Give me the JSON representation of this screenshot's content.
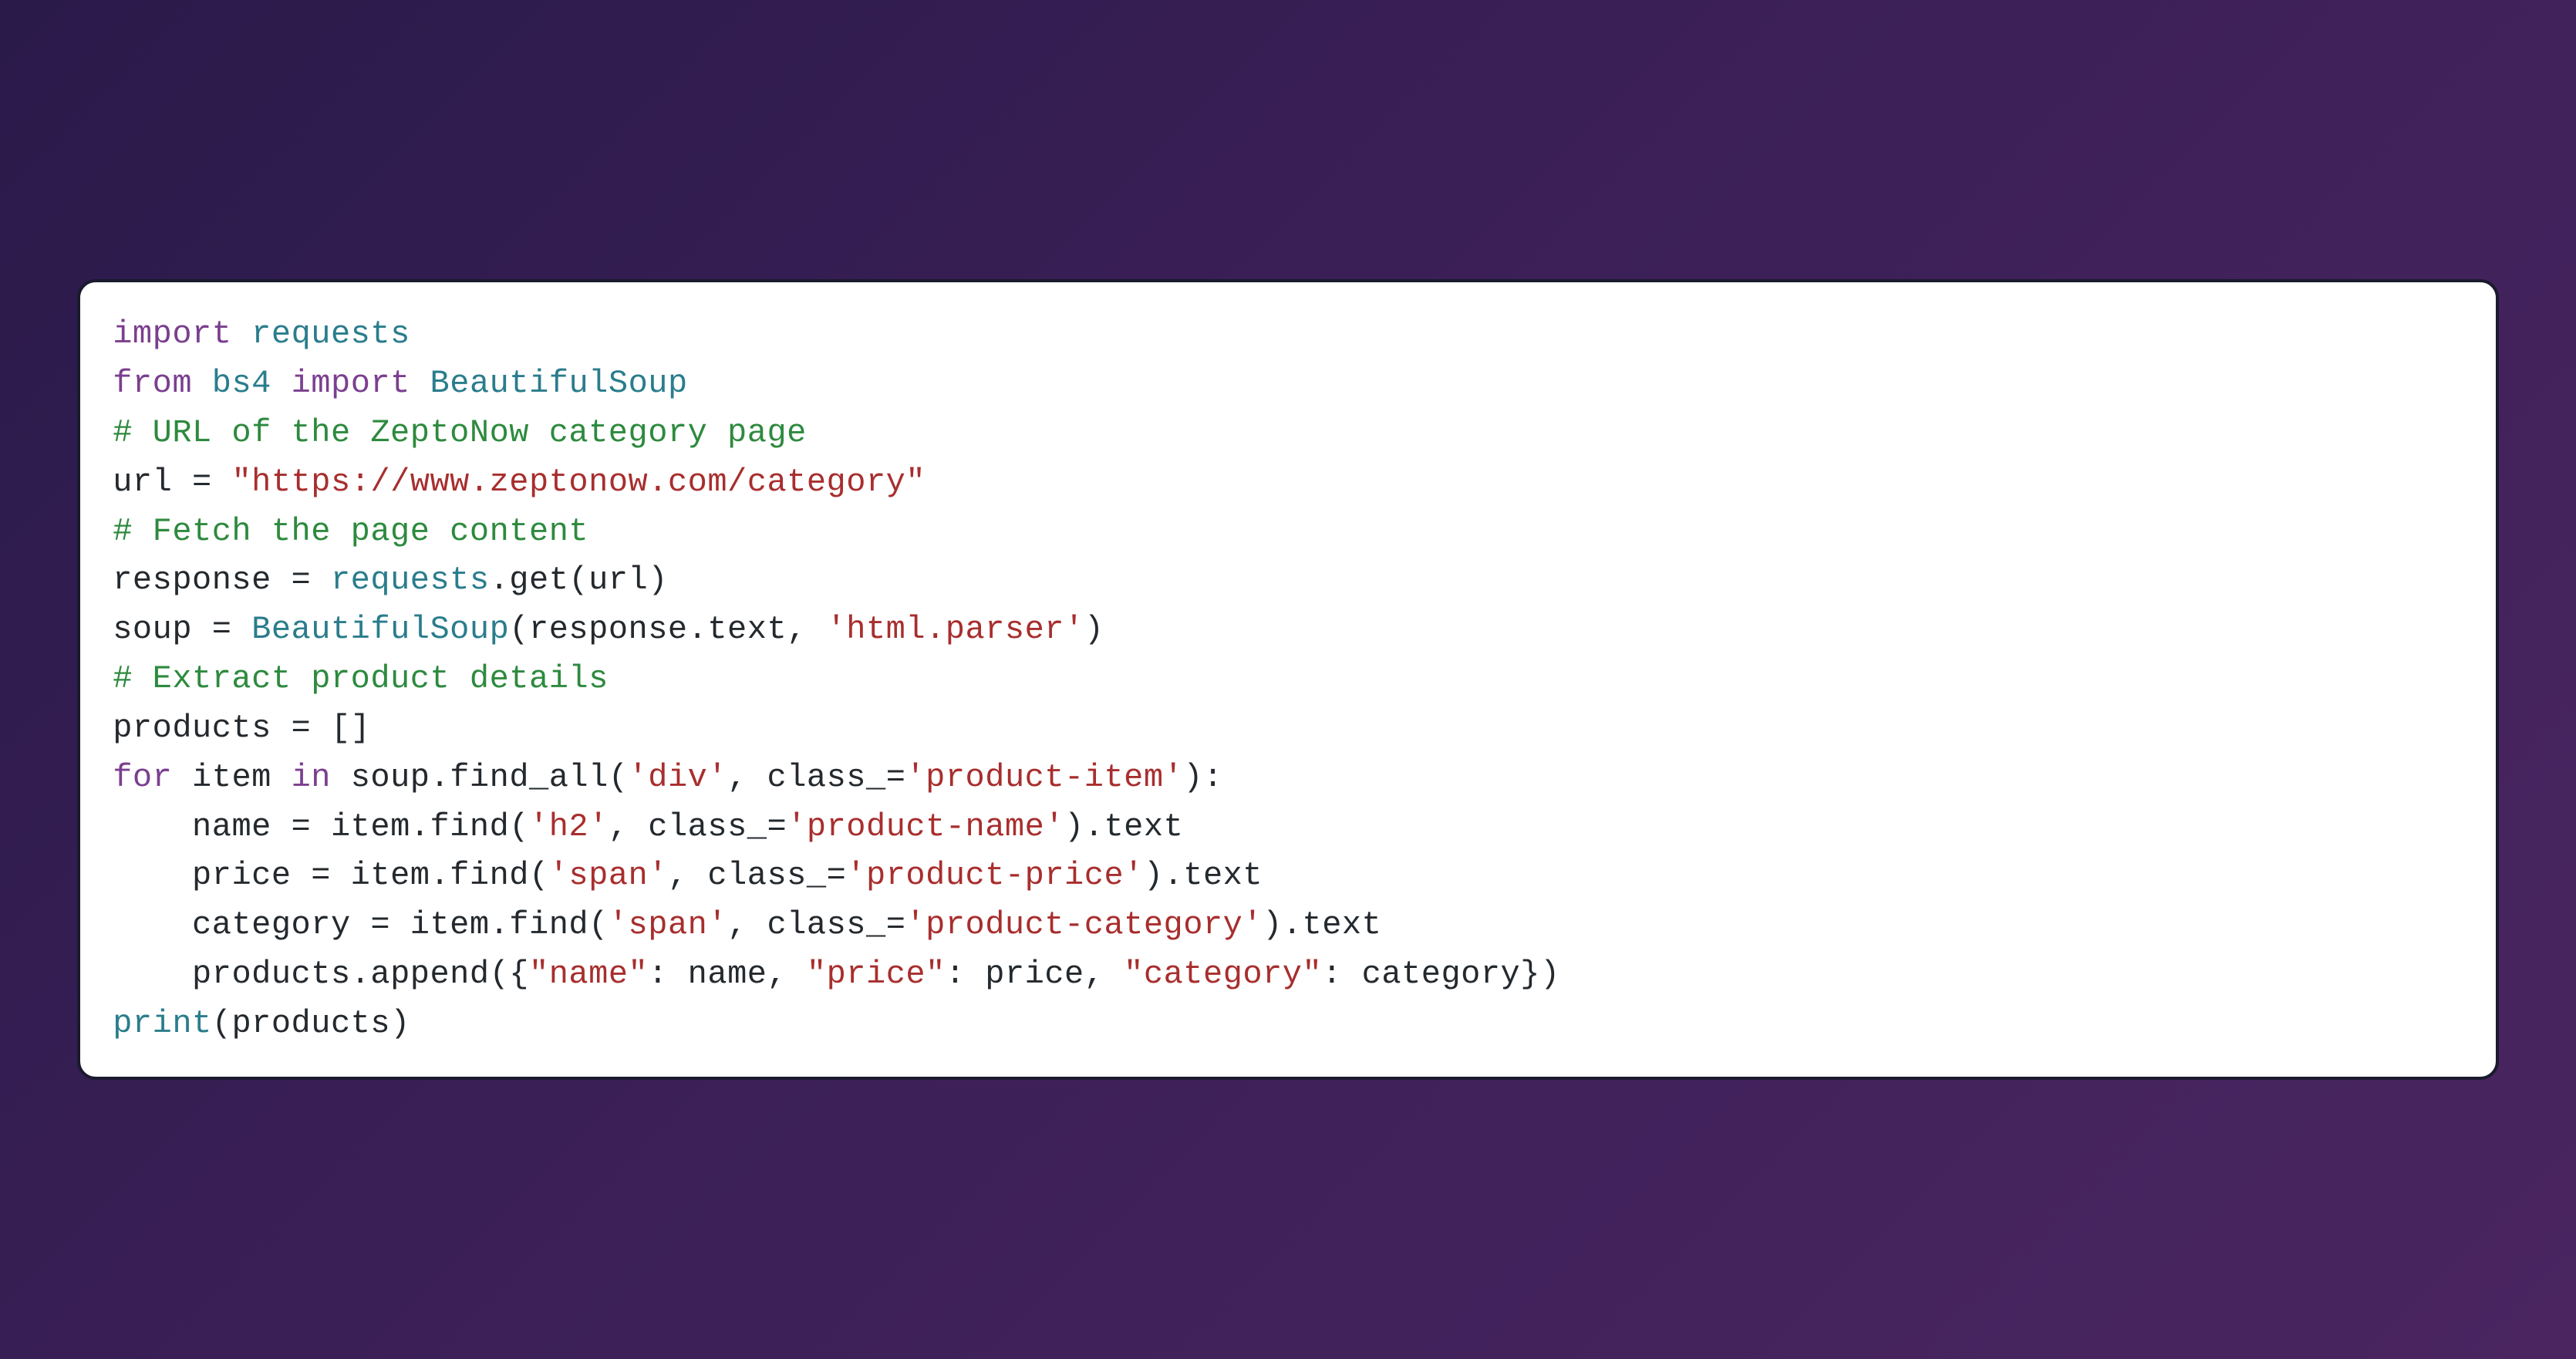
{
  "code": {
    "line1": {
      "kw": "import",
      "module": "requests"
    },
    "line2": {
      "kw1": "from",
      "module1": "bs4",
      "kw2": "import",
      "module2": "BeautifulSoup"
    },
    "line3": {
      "comment": "# URL of the ZeptoNow category page"
    },
    "line4": {
      "var": "url = ",
      "str": "\"https://www.zeptonow.com/category\""
    },
    "line5": {
      "comment": "# Fetch the page content"
    },
    "line6": {
      "text1": "response = ",
      "builtin": "requests",
      "text2": ".get(url)"
    },
    "line7": {
      "text1": "soup = ",
      "builtin": "BeautifulSoup",
      "text2": "(response.text, ",
      "str": "'html.parser'",
      "text3": ")"
    },
    "line8": {
      "comment": "# Extract product details"
    },
    "line9": {
      "text": "products = []"
    },
    "line10": {
      "kw1": "for",
      "text1": " item ",
      "kw2": "in",
      "text2": " soup.find_all(",
      "str1": "'div'",
      "text3": ", class_=",
      "str2": "'product-item'",
      "text4": "):"
    },
    "line11": {
      "indent": "    ",
      "text1": "name = item.find(",
      "str1": "'h2'",
      "text2": ", class_=",
      "str2": "'product-name'",
      "text3": ").text"
    },
    "line12": {
      "indent": "    ",
      "text1": "price = item.find(",
      "str1": "'span'",
      "text2": ", class_=",
      "str2": "'product-price'",
      "text3": ").text"
    },
    "line13": {
      "indent": "    ",
      "text1": "category = item.find(",
      "str1": "'span'",
      "text2": ", class_=",
      "str2": "'product-category'",
      "text3": ").text"
    },
    "line14": {
      "indent": "    ",
      "text1": "products.append({",
      "str1": "\"name\"",
      "text2": ": name, ",
      "str2": "\"price\"",
      "text3": ": price, ",
      "str3": "\"category\"",
      "text4": ": category})"
    },
    "line15": {
      "builtin": "print",
      "text": "(products)"
    }
  }
}
